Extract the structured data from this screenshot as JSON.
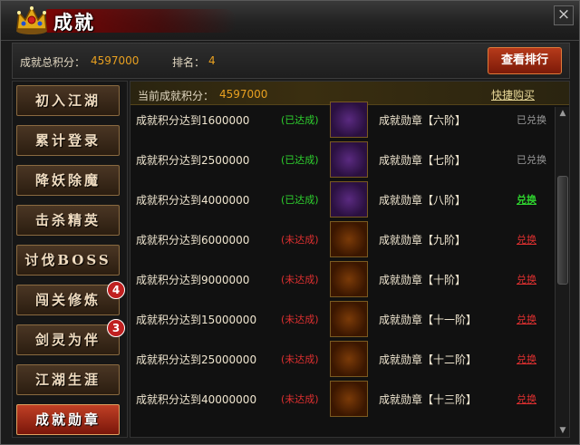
{
  "window": {
    "title": "成就"
  },
  "summary": {
    "total_label": "成就总积分：",
    "total_value": "4597000",
    "rank_label": "排名：",
    "rank_value": "4",
    "rank_button": "查看排行"
  },
  "sidebar": {
    "items": [
      {
        "label": "初入江湖",
        "badge": ""
      },
      {
        "label": "累计登录",
        "badge": ""
      },
      {
        "label": "降妖除魔",
        "badge": ""
      },
      {
        "label": "击杀精英",
        "badge": ""
      },
      {
        "label": "讨伐BOSS",
        "badge": ""
      },
      {
        "label": "闯关修炼",
        "badge": "4"
      },
      {
        "label": "剑灵为伴",
        "badge": "3"
      },
      {
        "label": "江湖生涯",
        "badge": ""
      },
      {
        "label": "成就勋章",
        "badge": "",
        "active": true
      }
    ]
  },
  "main": {
    "current_label": "当前成就积分：",
    "current_value": "4597000",
    "buy_link": "快捷购买",
    "rows": [
      {
        "requirement": "成就积分达到1600000",
        "status": "(已达成)",
        "medal": "成就勋章【六阶】",
        "action": "已兑换"
      },
      {
        "requirement": "成就积分达到2500000",
        "status": "(已达成)",
        "medal": "成就勋章【七阶】",
        "action": "已兑换"
      },
      {
        "requirement": "成就积分达到4000000",
        "status": "(已达成)",
        "medal": "成就勋章【八阶】",
        "action": "兑换"
      },
      {
        "requirement": "成就积分达到6000000",
        "status": "(未达成)",
        "medal": "成就勋章【九阶】",
        "action": "兑换"
      },
      {
        "requirement": "成就积分达到9000000",
        "status": "(未达成)",
        "medal": "成就勋章【十阶】",
        "action": "兑换"
      },
      {
        "requirement": "成就积分达到15000000",
        "status": "(未达成)",
        "medal": "成就勋章【十一阶】",
        "action": "兑换"
      },
      {
        "requirement": "成就积分达到25000000",
        "status": "(未达成)",
        "medal": "成就勋章【十二阶】",
        "action": "兑换"
      },
      {
        "requirement": "成就积分达到40000000",
        "status": "(未达成)",
        "medal": "成就勋章【十三阶】",
        "action": "兑换"
      }
    ]
  },
  "colors": {
    "accent": "#e8a020",
    "achieved": "#2ed12e",
    "unachieved": "#e03030"
  }
}
